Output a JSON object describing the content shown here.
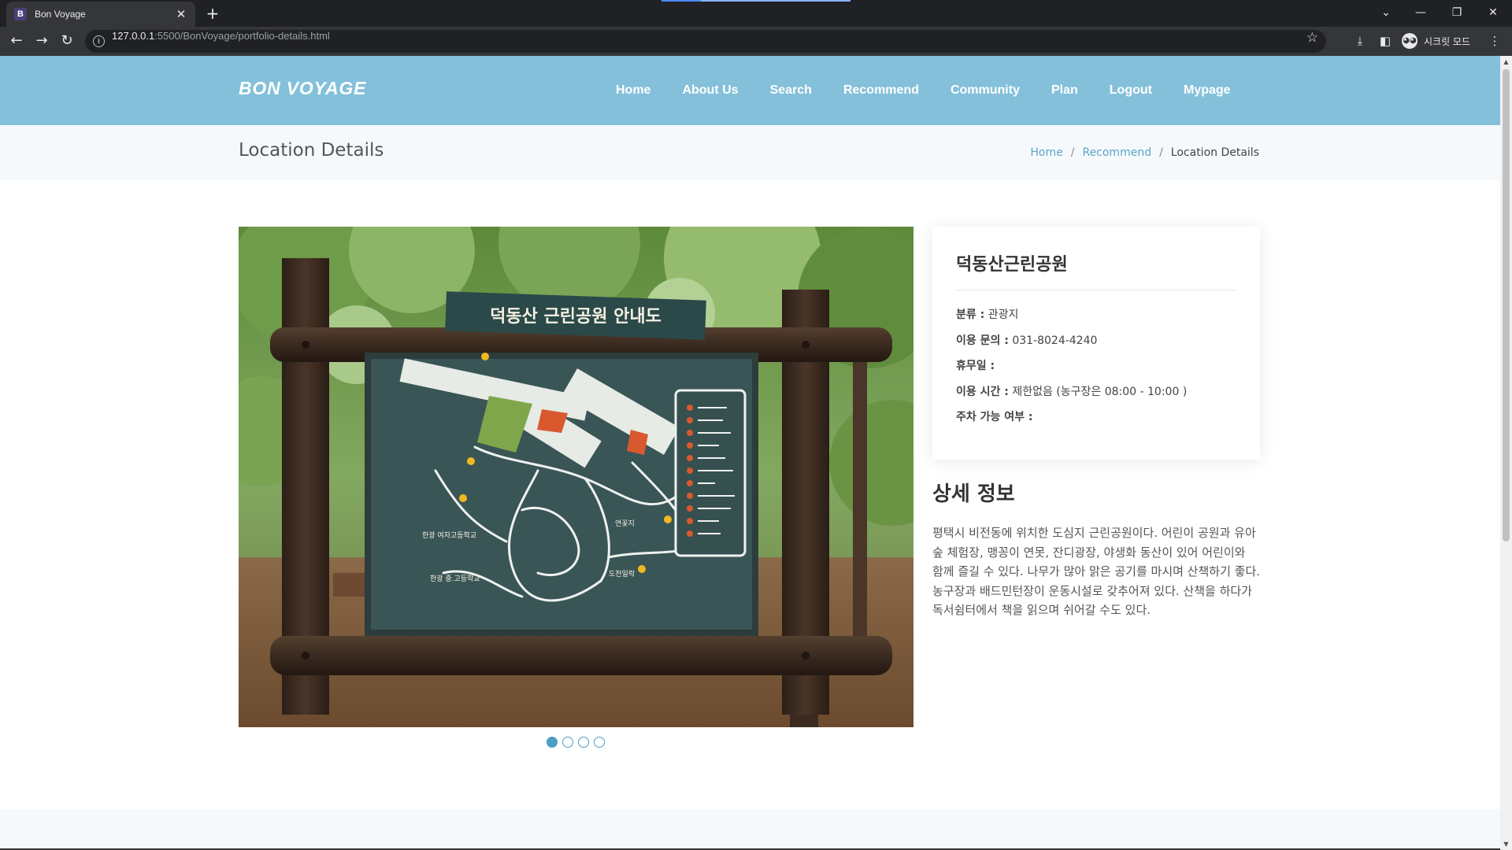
{
  "browser": {
    "tab_title": "Bon Voyage",
    "tab_favicon": "B",
    "url_host": "127.0.0.1",
    "url_rest": ":5500/BonVoyage/portfolio-details.html",
    "incognito_label": "시크릿 모드",
    "icons": [
      "back-icon",
      "forward-icon",
      "reload-icon",
      "info-icon",
      "star-icon",
      "download-icon",
      "side-panel-icon",
      "menu-icon",
      "minimize-icon",
      "restore-icon",
      "close-icon",
      "tab-search-icon"
    ]
  },
  "header": {
    "logo": "BON VOYAGE",
    "nav": [
      "Home",
      "About Us",
      "Search",
      "Recommend",
      "Community",
      "Plan",
      "Logout",
      "Mypage"
    ]
  },
  "breadcrumbs": {
    "title": "Location Details",
    "items": [
      "Home",
      "Recommend",
      "Location Details"
    ],
    "separator": "/"
  },
  "location": {
    "name": "덕동산근린공원",
    "fields": [
      {
        "label": "분류 :",
        "value": " 관광지"
      },
      {
        "label": "이용 문의 :",
        "value": " 031-8024-4240"
      },
      {
        "label": "휴무일 :",
        "value": ""
      },
      {
        "label": "이용 시간 :",
        "value": " 제한없음 (농구장은 08:00 - 10:00 )"
      },
      {
        "label": "주차 가능 여부 :",
        "value": ""
      }
    ],
    "detail_title": "상세 정보",
    "detail_text": "평택시 비전동에 위치한 도심지 근린공원이다. 어린이 공원과 유아 숲 체험장, 맹꽁이 연못, 잔디광장, 야생화 동산이 있어 어린이와 함께 즐길 수 있다. 나무가 많아 맑은 공기를 마시며 산책하기 좋다. 농구장과 배드민턴장이 운동시설로 갖추어져 있다. 산책을 하다가 독서쉼터에서 책을 읽으며 쉬어갈 수도 있다."
  },
  "sign_image": {
    "sign_text": "덕동산 근린공원 안내도",
    "map_labels": [
      "한광 여자고등학교",
      "한광 중.고등학교",
      "도천일락",
      "연꽃지"
    ]
  },
  "slider": {
    "total": 4,
    "active": 1
  },
  "colors": {
    "header": "#84c0da",
    "accent": "#4d9dc5",
    "crumb_bg": "#f6f9fc"
  }
}
